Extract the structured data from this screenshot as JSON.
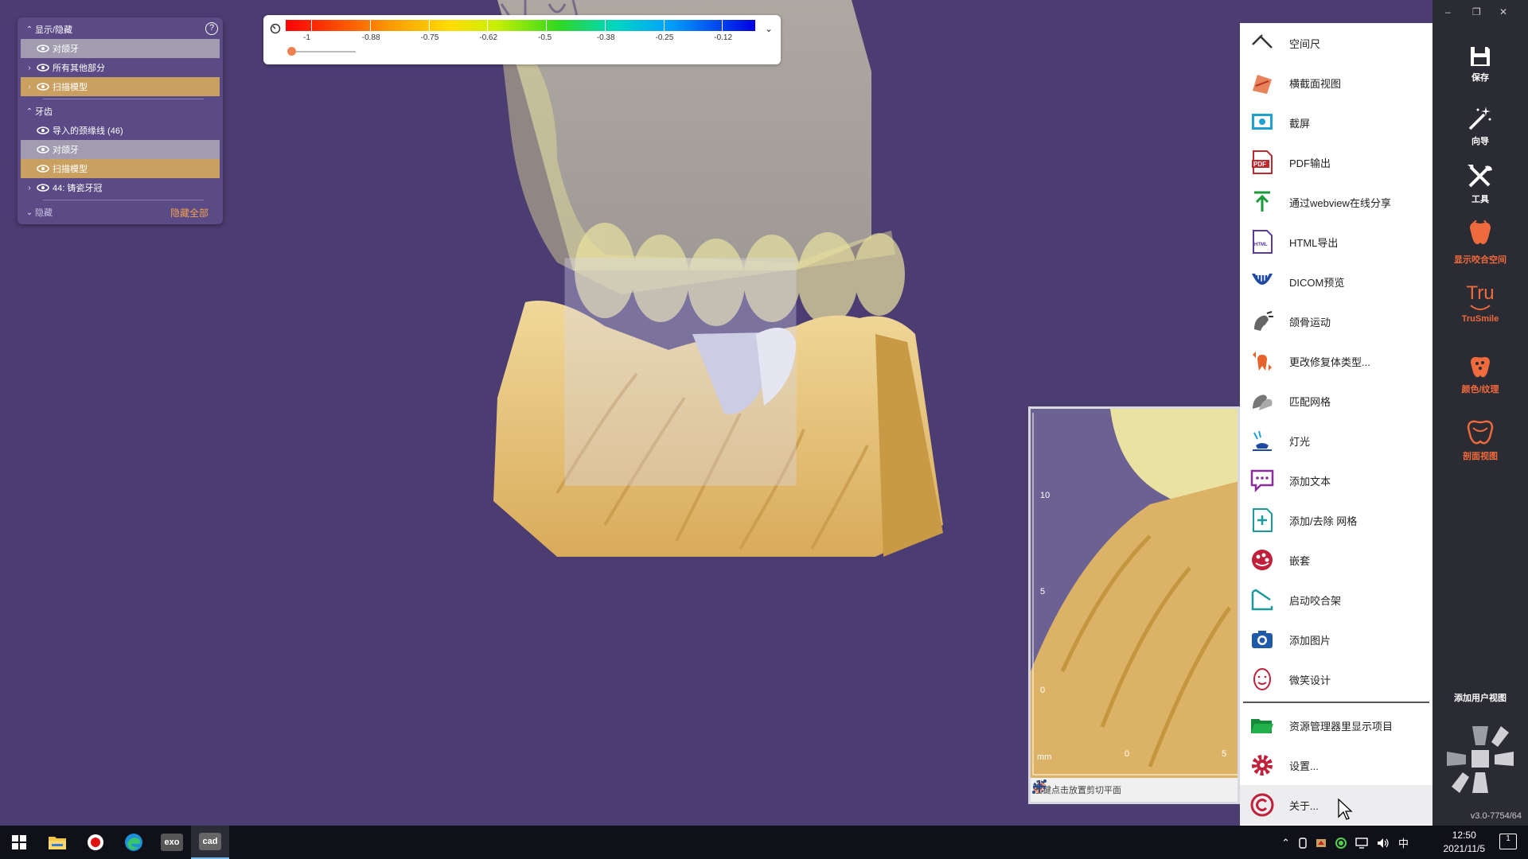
{
  "tree": {
    "show_hide_header": "显示/隐藏",
    "help_icon": "?",
    "rows_top": [
      {
        "label": "对颌牙",
        "style": "grey",
        "chevron": ""
      },
      {
        "label": "所有其他部分",
        "style": "none",
        "chevron": "›"
      },
      {
        "label": "扫描模型",
        "style": "tan",
        "chevron": "›"
      }
    ],
    "teeth_header": "牙齿",
    "rows_teeth": [
      {
        "label": "导入的颈缘线 (46)",
        "style": "none",
        "chevron": ""
      },
      {
        "label": "对颌牙",
        "style": "grey",
        "chevron": ""
      },
      {
        "label": "扫描模型",
        "style": "tan",
        "chevron": ""
      },
      {
        "label": "44: 铸瓷牙冠",
        "style": "none",
        "chevron": "›"
      }
    ],
    "hidden_header": "隐藏",
    "hide_all": "隐藏全部"
  },
  "color_scale": {
    "ticks": [
      "-1",
      "-0.88",
      "-0.75",
      "-0.62",
      "-0.5",
      "-0.38",
      "-0.25",
      "-0.12"
    ]
  },
  "clip_window": {
    "y_labels": [
      "10",
      "5",
      "0"
    ],
    "x_labels": [
      "mm",
      "0",
      "5"
    ],
    "hint": "左键点击放置剪切平面"
  },
  "menu": {
    "items": [
      {
        "label": "空间尺",
        "icon": "ruler-icon"
      },
      {
        "label": "横截面视图",
        "icon": "cross-section-icon"
      },
      {
        "label": "截屏",
        "icon": "screenshot-icon"
      },
      {
        "label": "PDF输出",
        "icon": "pdf-icon"
      },
      {
        "label": "通过webview在线分享",
        "icon": "upload-share-icon"
      },
      {
        "label": "HTML导出",
        "icon": "html-icon"
      },
      {
        "label": "DICOM预览",
        "icon": "dicom-icon"
      },
      {
        "label": "颌骨运动",
        "icon": "jaw-motion-icon"
      },
      {
        "label": "更改修复体类型...",
        "icon": "change-type-icon"
      },
      {
        "label": "匹配网格",
        "icon": "match-mesh-icon"
      },
      {
        "label": "灯光",
        "icon": "lamp-icon"
      },
      {
        "label": "添加文本",
        "icon": "add-text-icon"
      },
      {
        "label": "添加/去除 网格",
        "icon": "add-mesh-icon"
      },
      {
        "label": "嵌套",
        "icon": "nesting-icon"
      },
      {
        "label": "启动咬合架",
        "icon": "articulator-icon"
      },
      {
        "label": "添加图片",
        "icon": "camera-icon"
      },
      {
        "label": "微笑设计",
        "icon": "smile-design-icon"
      }
    ],
    "items_bottom": [
      {
        "label": "资源管理器里显示项目",
        "icon": "folder-icon"
      },
      {
        "label": "设置...",
        "icon": "gear-icon"
      },
      {
        "label": "关于...",
        "icon": "copyright-icon"
      }
    ]
  },
  "sidebar": {
    "save": "保存",
    "wizard": "向导",
    "tools": "工具",
    "occlusal_space": "显示咬合空间",
    "trusmile": "TruSmile",
    "trusmile_logo": "Tru",
    "color_texture": "颜色/纹理",
    "section_view": "剖面视图",
    "add_user_view": "添加用户视图",
    "version": "v3.0-7754/64",
    "win_min": "–",
    "win_restore": "❐",
    "win_close": "✕"
  },
  "taskbar": {
    "time": "12:50",
    "date": "2021/11/5",
    "ime": "中",
    "notifications": "1",
    "exo_label": "exo",
    "cad_label": "cad"
  },
  "accent": {
    "orange": "#ef6a3c",
    "tan": "#c9a060",
    "purple_bg": "#4b3c72"
  }
}
